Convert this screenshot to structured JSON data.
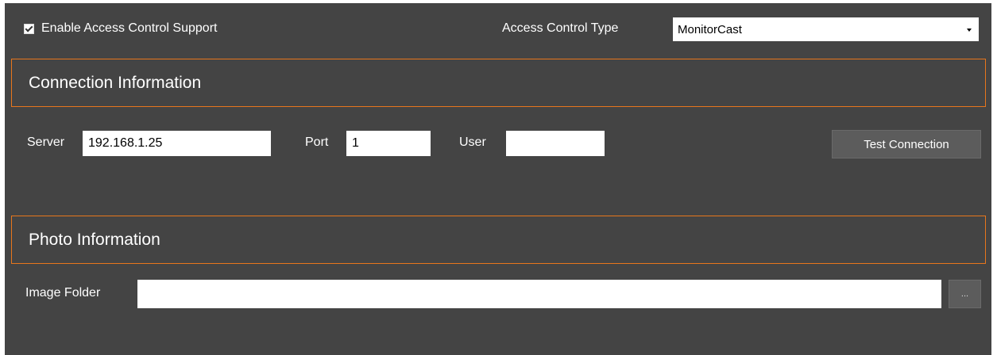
{
  "enable_access_control": {
    "label": "Enable Access Control Support",
    "checked": true
  },
  "access_control_type": {
    "label": "Access Control Type",
    "value": "MonitorCast"
  },
  "connection_section": {
    "title": "Connection Information",
    "server_label": "Server",
    "server_value": "192.168.1.25",
    "port_label": "Port",
    "port_value": "1",
    "user_label": "User",
    "user_value": "",
    "test_button_label": "Test Connection"
  },
  "photo_section": {
    "title": "Photo Information",
    "image_folder_label": "Image Folder",
    "image_folder_value": "",
    "browse_button_label": "..."
  },
  "colors": {
    "panel_background": "#444444",
    "section_border_accent": "#e8761c",
    "button_background": "#5c5c5c"
  }
}
